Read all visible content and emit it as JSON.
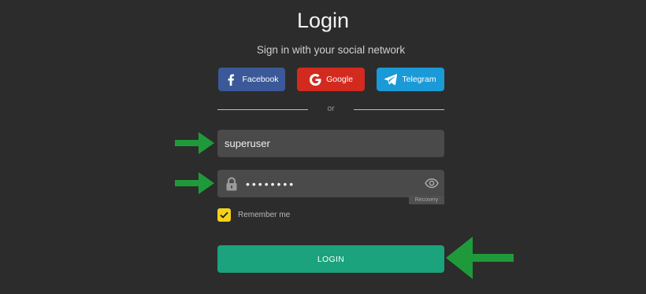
{
  "title": "Login",
  "subtitle": "Sign in with your social network",
  "social": {
    "facebook": {
      "label": "Facebook",
      "icon": "facebook-icon",
      "color": "#3b5998"
    },
    "google": {
      "label": "Google",
      "icon": "google-icon",
      "color": "#d32a1f"
    },
    "telegram": {
      "label": "Telegram",
      "icon": "telegram-icon",
      "color": "#1a9ad6"
    }
  },
  "divider_text": "or",
  "username": {
    "value": "superuser"
  },
  "password": {
    "value": "••••••••",
    "lock_icon": "lock-icon",
    "toggle_icon": "eye-icon"
  },
  "recovery_label": "Recovery",
  "remember": {
    "label": "Remember me",
    "checked": true,
    "color": "#f4d21c"
  },
  "login_label": "LOGIN",
  "login_color": "#1aa37c",
  "annotation_arrows": {
    "color": "#1f9a3a",
    "icon": "arrow-right-icon, arrow-left-icon"
  }
}
